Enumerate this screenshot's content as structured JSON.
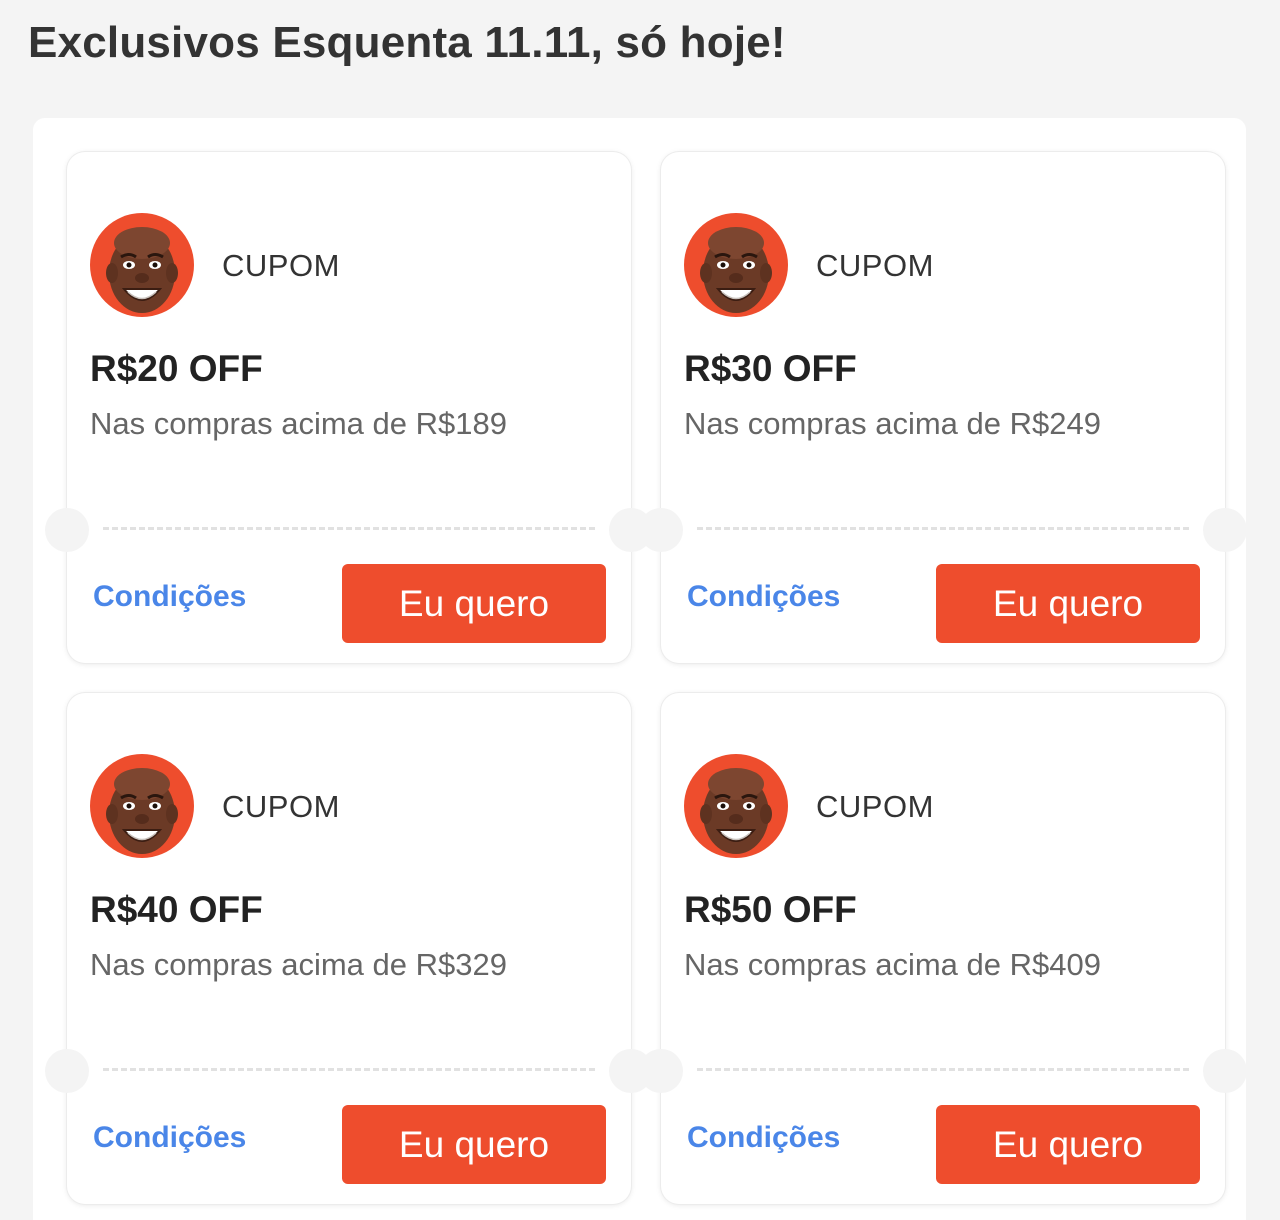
{
  "header": {
    "title": "Exclusivos Esquenta 11.11, só hoje!"
  },
  "theme": {
    "accent": "#ee4d2d",
    "link": "#4a86e8",
    "background": "#f4f4f4"
  },
  "coupons": [
    {
      "avatar_icon": "avatar-face-icon",
      "label": "CUPOM",
      "amount": "R$20 OFF",
      "condition": "Nas compras acima de R$189",
      "conditions_link": "Condições",
      "cta": "Eu quero"
    },
    {
      "avatar_icon": "avatar-face-icon",
      "label": "CUPOM",
      "amount": "R$30 OFF",
      "condition": "Nas compras acima de R$249",
      "conditions_link": "Condições",
      "cta": "Eu quero"
    },
    {
      "avatar_icon": "avatar-face-icon",
      "label": "CUPOM",
      "amount": "R$40 OFF",
      "condition": "Nas compras acima de R$329",
      "conditions_link": "Condições",
      "cta": "Eu quero"
    },
    {
      "avatar_icon": "avatar-face-icon",
      "label": "CUPOM",
      "amount": "R$50 OFF",
      "condition": "Nas compras acima de R$409",
      "conditions_link": "Condições",
      "cta": "Eu quero"
    }
  ]
}
